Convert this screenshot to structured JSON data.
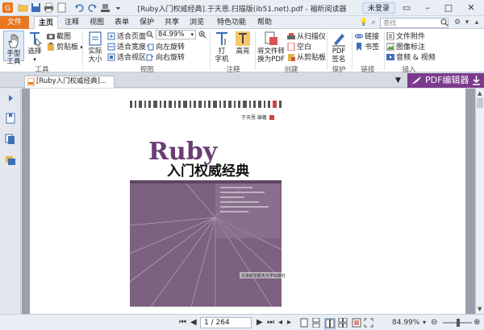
{
  "titlebar": {
    "title": "[Ruby入门权威经典].于天恩.扫描版(ib51.net).pdf - 福昕阅读器",
    "login": "未登录"
  },
  "ribbon_tabs": {
    "file": "文件",
    "tabs": [
      "主页",
      "注释",
      "视图",
      "表单",
      "保护",
      "共享",
      "浏览",
      "特色功能",
      "帮助"
    ],
    "active": "主页",
    "search_placeholder": "查找"
  },
  "tools_group": {
    "hand": "手型\n工具",
    "hand_l1": "手型",
    "hand_l2": "工具",
    "select": "选择",
    "screenshot": "截图",
    "clipboard": "剪贴板",
    "label": "工具"
  },
  "view_group": {
    "actual_l1": "实际",
    "actual_l2": "大小",
    "fit_page": "适合页面",
    "fit_width": "适合宽度",
    "fit_visible": "适合视区",
    "zoom": "84.99%",
    "rotate_left": "向左旋转",
    "rotate_right": "向右旋转",
    "label": "视图"
  },
  "annot_group": {
    "typewriter_l1": "打",
    "typewriter_l2": "字机",
    "highlight": "高亮",
    "label": "注释"
  },
  "create_group": {
    "convert_l1": "将文件转",
    "convert_l2": "换为PDF",
    "from_scanner": "从扫描仪",
    "blank": "空白",
    "from_clipboard": "从剪贴板",
    "label": "创建"
  },
  "protect_group": {
    "sign_l1": "PDF",
    "sign_l2": "签名",
    "label": "保护"
  },
  "link_group": {
    "link": "链接",
    "bookmark": "书签",
    "label": "链接"
  },
  "insert_group": {
    "attachment": "文件附件",
    "image": "图像标注",
    "audio": "音频 & 视频",
    "label": "插入"
  },
  "doc_tab": {
    "title": "[Ruby入门权威经典]..."
  },
  "pdf_editor": "PDF编辑器",
  "book": {
    "author": "于天恩 编著",
    "title_ruby": "Ruby",
    "title_cn": "入门权威经典",
    "publisher": "北京航空航天大学出版社"
  },
  "status": {
    "page": "1 / 264",
    "zoom": "84.99%"
  },
  "colors": {
    "accent_orange": "#e87722",
    "pdf_editor_purple": "#7b3a8c",
    "cover_purple": "#7d6280",
    "title_purple": "#6a3d74"
  }
}
